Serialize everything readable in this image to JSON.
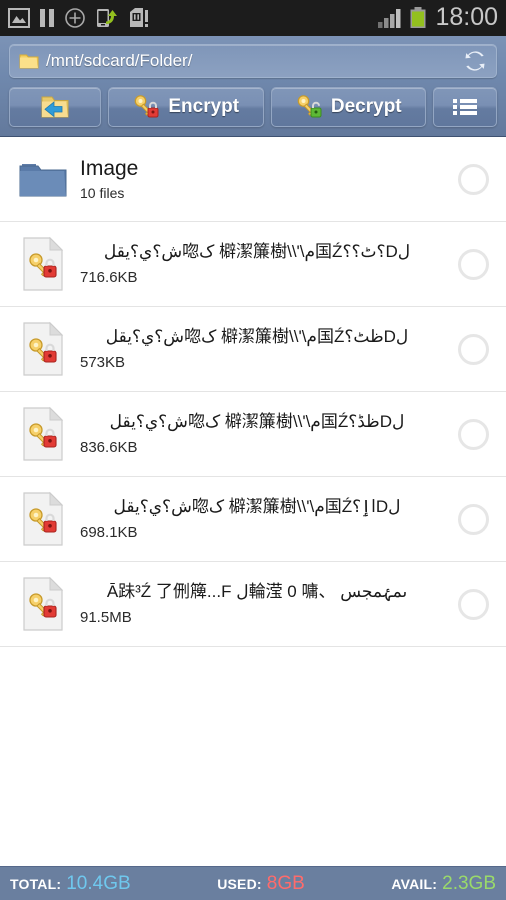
{
  "statusbar": {
    "icons": [
      {
        "name": "gallery-image-icon"
      },
      {
        "name": "pause-icon"
      },
      {
        "name": "plus-circle-icon"
      },
      {
        "name": "usb-transfer-icon"
      },
      {
        "name": "sd-card-warning-icon"
      },
      {
        "name": "signal-bars-icon"
      },
      {
        "name": "battery-icon"
      }
    ],
    "clock": "18:00"
  },
  "header": {
    "path": "/mnt/sdcard/Folder/",
    "path_icon": "folder-icon",
    "refresh_icon": "refresh-icon",
    "toolbar": {
      "back_label": "",
      "back_icon": "folder-back-icon",
      "encrypt_label": "Encrypt",
      "encrypt_icon": "key-lock-red-icon",
      "decrypt_label": "Decrypt",
      "decrypt_icon": "key-lock-green-icon",
      "menu_icon": "list-menu-icon"
    }
  },
  "list": {
    "items": [
      {
        "type": "folder",
        "icon": "folder-icon",
        "name": "Image",
        "sub": "10 files",
        "checked": false
      },
      {
        "type": "file",
        "icon": "encrypted-file-icon",
        "name": "لD؟ٹ؟؟国Źم\\'\\\\檘潔簾樹  ک唿ش؟ي؟يقل",
        "sub": "716.6KB",
        "checked": false
      },
      {
        "type": "file",
        "icon": "encrypted-file-icon",
        "name": "لDظٹ؟国Źم\\'\\\\檘潔簾樹  ک唿ش؟ي؟يقل",
        "sub": "573KB",
        "checked": false
      },
      {
        "type": "file",
        "icon": "encrypted-file-icon",
        "name": "لDظڈ؟国Źم\\'\\\\檘潔簾樹  ک唿ش؟ي؟يقل",
        "sub": "836.6KB",
        "checked": false
      },
      {
        "type": "file",
        "icon": "encrypted-file-icon",
        "name": "لDاٳ؟国Źم\\'\\\\檘潔簾樹  ک唿ش؟ي؟يقل",
        "sub": "698.1KB",
        "checked": false
      },
      {
        "type": "file",
        "icon": "encrypted-file-icon",
        "name": "ىمۂمجس 、輪滢  0 嘃ل Ā跊³Ź 了侀簰...F",
        "sub": "91.5MB",
        "checked": false
      }
    ]
  },
  "bottombar": {
    "total_label": "TOTAL:",
    "total_value": "10.4GB",
    "total_color": "#6fc8ee",
    "used_label": "USED:",
    "used_value": "8GB",
    "used_color": "#ff6b6b",
    "avail_label": "AVAIL:",
    "avail_value": "2.3GB",
    "avail_color": "#9ada6a"
  }
}
